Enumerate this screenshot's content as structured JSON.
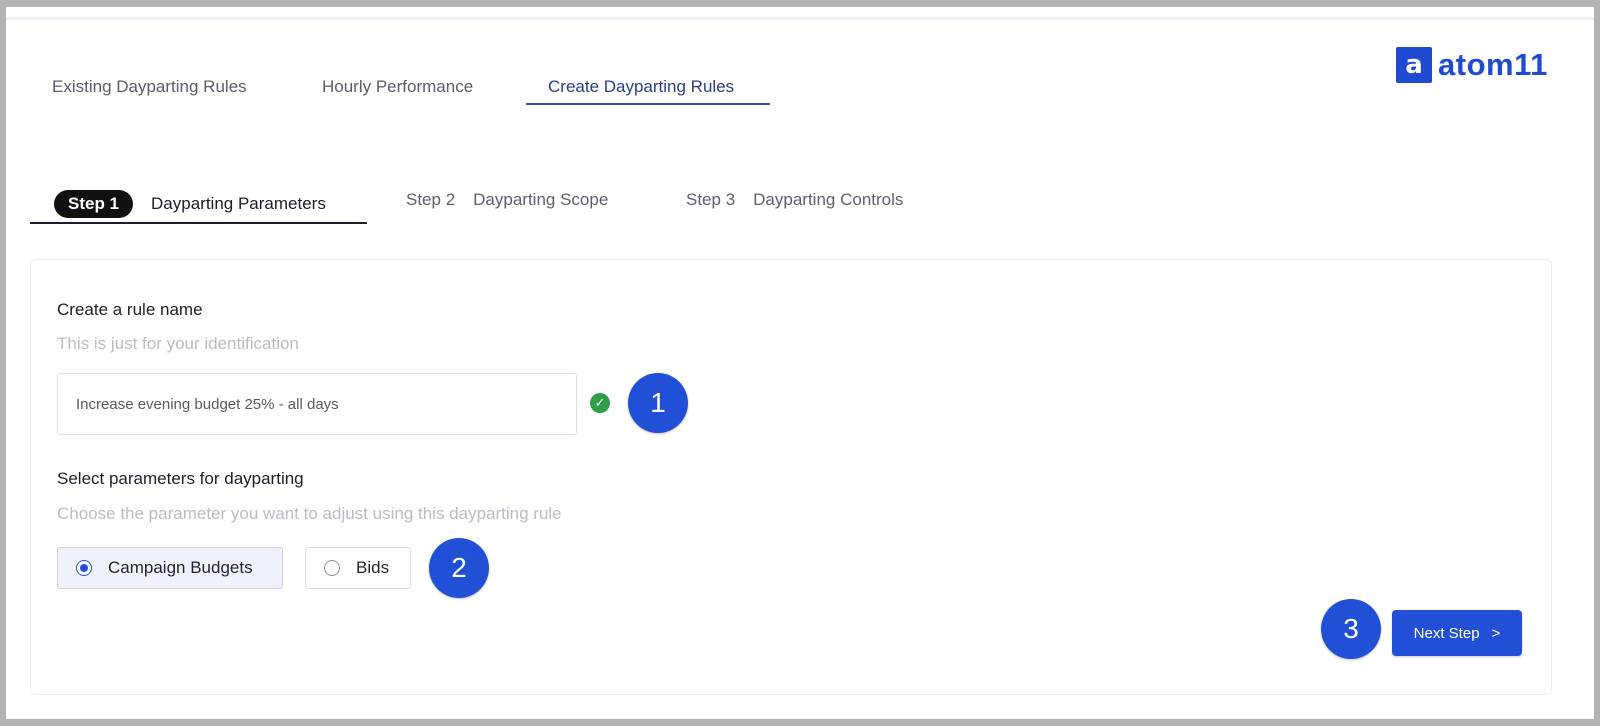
{
  "brand": {
    "logo_mark": "a",
    "name": "atom11",
    "accent": "#1f4bd3"
  },
  "main_tabs": [
    {
      "label": "Existing Dayparting Rules",
      "active": false
    },
    {
      "label": "Hourly Performance",
      "active": false
    },
    {
      "label": "Create Dayparting Rules",
      "active": true
    }
  ],
  "steps": [
    {
      "num": "Step 1",
      "label": "Dayparting Parameters",
      "active": true
    },
    {
      "num": "Step 2",
      "label": "Dayparting Scope",
      "active": false
    },
    {
      "num": "Step 3",
      "label": "Dayparting Controls",
      "active": false
    }
  ],
  "rule_name": {
    "heading": "Create a rule name",
    "hint": "This is just for your identification",
    "value": "Increase evening budget 25% - all days",
    "valid_icon": "check-circle-icon"
  },
  "parameters": {
    "heading": "Select parameters for dayparting",
    "hint": "Choose the parameter you want to adjust using this dayparting rule",
    "options": [
      {
        "label": "Campaign Budgets",
        "selected": true
      },
      {
        "label": "Bids",
        "selected": false
      }
    ]
  },
  "callouts": [
    "1",
    "2",
    "3"
  ],
  "next_button": {
    "label": "Next Step",
    "icon": "chevron-right-icon",
    "glyph": ">"
  }
}
